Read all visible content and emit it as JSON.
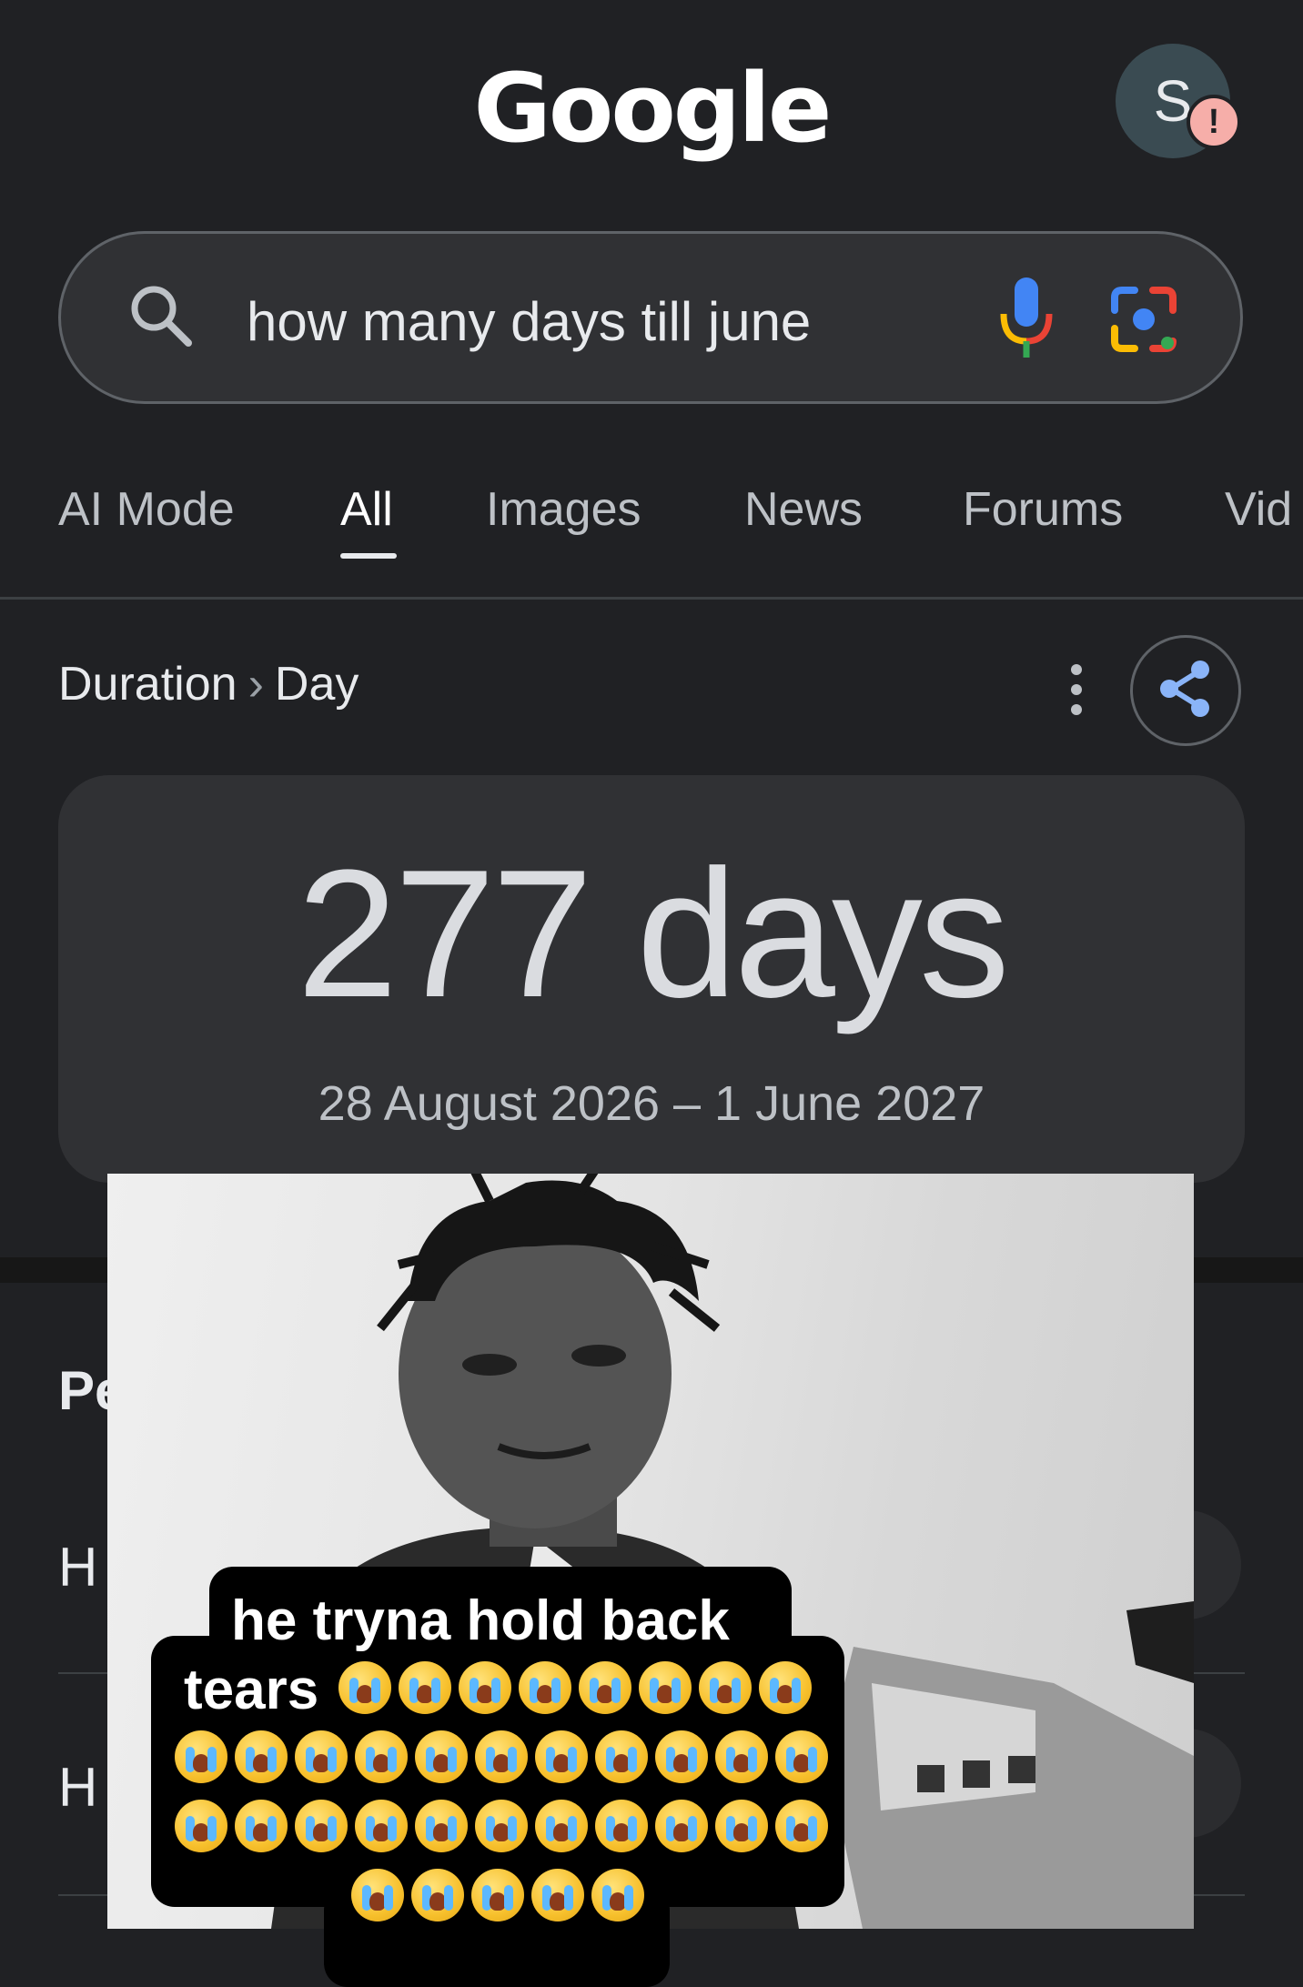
{
  "header": {
    "logo_text": "Google",
    "avatar_letter": "S",
    "avatar_alert": "!"
  },
  "search": {
    "query": "how many days till june",
    "icons": [
      "search-icon",
      "mic-icon",
      "lens-icon"
    ]
  },
  "tabs": [
    {
      "label": "AI Mode",
      "active": false
    },
    {
      "label": "All",
      "active": true
    },
    {
      "label": "Images",
      "active": false
    },
    {
      "label": "News",
      "active": false
    },
    {
      "label": "Forums",
      "active": false
    },
    {
      "label": "Vid",
      "active": false
    }
  ],
  "result": {
    "breadcrumb": [
      "Duration",
      "Day"
    ],
    "breadcrumb_sep": "›",
    "value": "277 days",
    "range": "28 August 2026 – 1 June 2027"
  },
  "behind_overlay": {
    "heading_fragment": "Pe",
    "row1_fragment": "H",
    "row2_fragment": "H"
  },
  "overlay": {
    "caption_line1": "he tryna hold back",
    "caption_line2_text": "tears",
    "emoji": "loudly-crying-face",
    "emoji_rows": [
      8,
      11,
      11,
      5
    ]
  },
  "colors": {
    "background": "#202124",
    "surface": "#303134",
    "text": "#e8eaed",
    "mic_blue": "#4285f4",
    "mic_red": "#ea4335",
    "mic_yellow": "#fbbc04",
    "mic_green": "#34a853"
  }
}
